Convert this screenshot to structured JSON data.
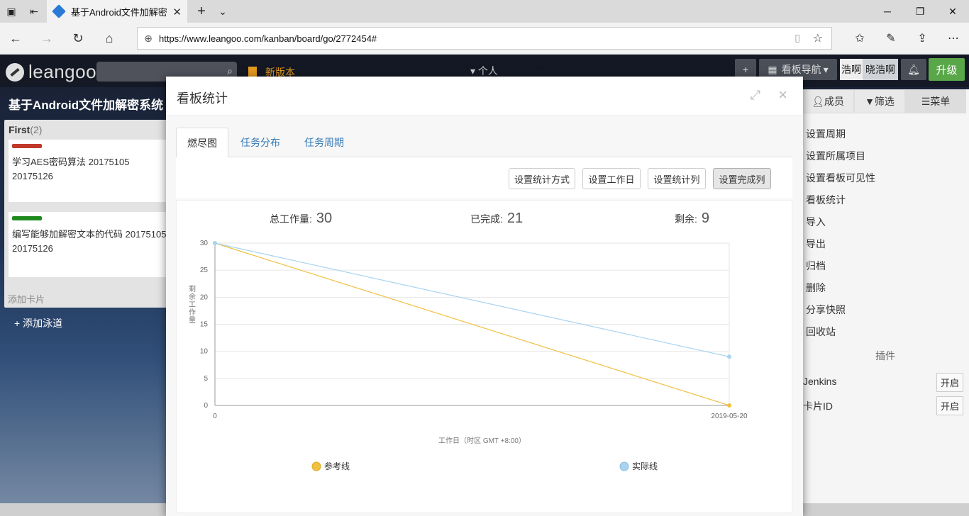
{
  "browser": {
    "tab_title": "基于Android文件加解密",
    "url": "https://www.leangoo.com/kanban/board/go/2772454#"
  },
  "app": {
    "logo_text": "leangoo",
    "new_version": "新版本",
    "personal": "个人",
    "board_nav": "看板导航",
    "user_short": "浩啊",
    "user_name": "晓浩啊",
    "upgrade": "升级",
    "board_title": "基于Android文件加解密系统"
  },
  "lane": {
    "name": "First",
    "count": "(2)",
    "cards": [
      {
        "text": "学习AES密码算法  20175105  20175126",
        "color": "#c0392b"
      },
      {
        "text": "编写能够加解密文本的代码  20175105  20175126",
        "color": "#1e8a1e"
      }
    ],
    "add_card": "添加卡片",
    "add_lane": "添加泳道"
  },
  "right_panel": {
    "tabs": [
      "成员",
      "筛选",
      "菜单"
    ],
    "menu": [
      "设置周期",
      "设置所属项目",
      "设置看板可见性",
      "看板统计",
      "导入",
      "导出",
      "归档",
      "删除",
      "分享快照",
      "回收站"
    ],
    "plugins_title": "插件",
    "plugins": [
      {
        "name": "Jenkins",
        "action": "开启"
      },
      {
        "name": "卡片ID",
        "action": "开启"
      }
    ]
  },
  "modal": {
    "title": "看板统计",
    "tabs": [
      "燃尽图",
      "任务分布",
      "任务周期"
    ],
    "buttons": [
      "设置统计方式",
      "设置工作日",
      "设置统计列",
      "设置完成列"
    ],
    "stats": {
      "total_label": "总工作量:",
      "total": "30",
      "done_label": "已完成:",
      "done": "21",
      "remain_label": "剩余:",
      "remain": "9"
    }
  },
  "chart_data": {
    "type": "line",
    "x": [
      "0",
      "2019-05-20"
    ],
    "series": [
      {
        "name": "参考线",
        "values": [
          30,
          0
        ],
        "color": "#f0c040"
      },
      {
        "name": "实际线",
        "values": [
          30,
          9
        ],
        "color": "#a8d4f0"
      }
    ],
    "xlabel": "工作日（时区 GMT +8:00）",
    "ylabel": "剩余工作量",
    "ylim": [
      0,
      30
    ],
    "yticks": [
      0,
      5,
      10,
      15,
      20,
      25,
      30
    ],
    "grid": true,
    "legend": "bottom"
  }
}
